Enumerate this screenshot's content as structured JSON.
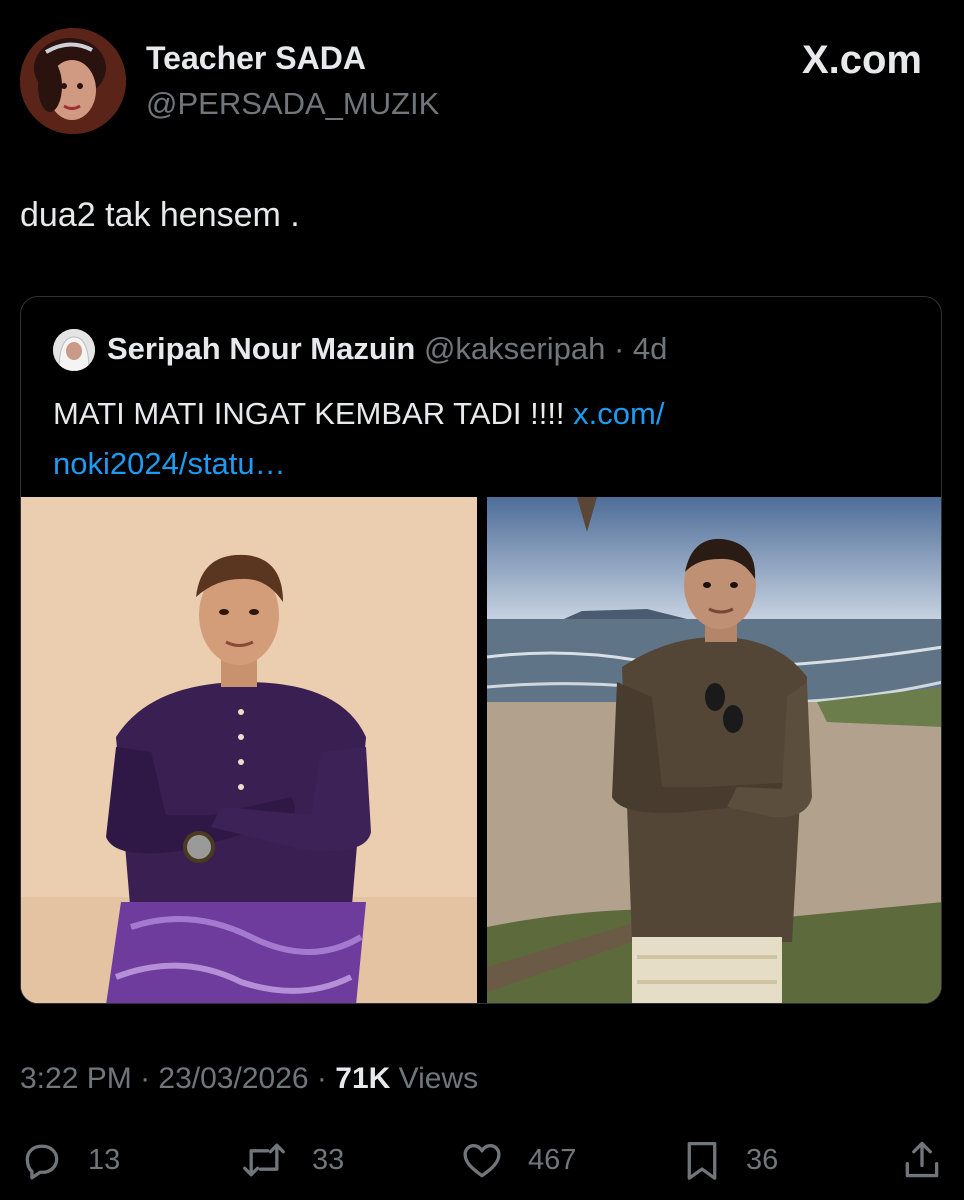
{
  "author": {
    "name": "Teacher SADA",
    "handle": "@PERSADA_MUZIK"
  },
  "brand": "X.com",
  "tweet": {
    "text": "dua2 tak hensem ."
  },
  "quoted": {
    "name": "Seripah Nour Mazuin",
    "handle": "@kakseripah",
    "separator": "·",
    "time": "4d",
    "text": "MATI MATI INGAT KEMBAR TADI !!!! ",
    "link": "x.com/ noki2024/statu…"
  },
  "meta": {
    "time": "3:22 PM",
    "date": "23/03/2026",
    "separator": "·",
    "views_count": "71K",
    "views_label": "Views"
  },
  "actions": {
    "replies": "13",
    "reposts": "33",
    "likes": "467",
    "bookmarks": "36"
  },
  "colors": {
    "background": "#000000",
    "text": "#e7e9ea",
    "muted": "#71767b",
    "link": "#1d9bf0",
    "border": "#2f3336"
  },
  "icons": {
    "reply": "reply-icon",
    "repost": "repost-icon",
    "like": "heart-icon",
    "bookmark": "bookmark-icon",
    "share": "share-icon"
  }
}
